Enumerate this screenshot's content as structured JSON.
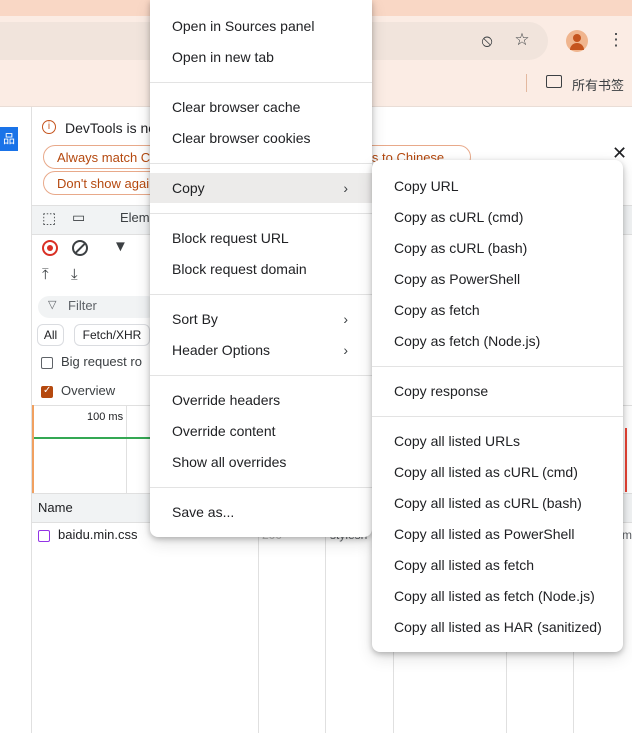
{
  "browser": {
    "bookmarks_folder_label": "所有书签",
    "icons": [
      "eye-slash-icon",
      "star-icon",
      "profile-avatar-icon",
      "kebab-menu-icon",
      "folder-icon"
    ]
  },
  "page": {
    "badge_text": "品"
  },
  "devtools": {
    "info_text": "DevTools is no",
    "pill_always": "Always match C",
    "pill_dont_show": "Don't show agai",
    "pill_switch": "ls to Chinese",
    "elements_tab": "Elem",
    "filter_placeholder": "Filter",
    "chip_all": "All",
    "chip_fetch": "Fetch/XHR",
    "big_rows": "Big request ro",
    "overview": "Overview",
    "overview_checked": true,
    "timeline_label": "100 ms",
    "col_name": "Name",
    "row": {
      "name": "baidu.min.css",
      "status": "200",
      "type": "stylesh",
      "end": "m"
    }
  },
  "context_menu": {
    "groups": [
      [
        "Open in Sources panel",
        "Open in new tab"
      ],
      [
        "Clear browser cache",
        "Clear browser cookies"
      ],
      [
        "Copy"
      ],
      [
        "Block request URL",
        "Block request domain"
      ],
      [
        "Sort By",
        "Header Options"
      ],
      [
        "Override headers",
        "Override content",
        "Show all overrides"
      ],
      [
        "Save as..."
      ]
    ],
    "submenu_items": [
      "Copy",
      "Sort By",
      "Header Options"
    ],
    "highlighted": "Copy"
  },
  "copy_submenu": {
    "groups": [
      [
        "Copy URL",
        "Copy as cURL (cmd)",
        "Copy as cURL (bash)",
        "Copy as PowerShell",
        "Copy as fetch",
        "Copy as fetch (Node.js)"
      ],
      [
        "Copy response"
      ],
      [
        "Copy all listed URLs",
        "Copy all listed as cURL (cmd)",
        "Copy all listed as cURL (bash)",
        "Copy all listed as PowerShell",
        "Copy all listed as fetch",
        "Copy all listed as fetch (Node.js)",
        "Copy all listed as HAR (sanitized)"
      ]
    ]
  },
  "colors": {
    "accent": "#b5490f",
    "toolbar": "#fbece4",
    "tabstrip": "#f9d7c5",
    "menu_highlight": "#ecebea"
  }
}
